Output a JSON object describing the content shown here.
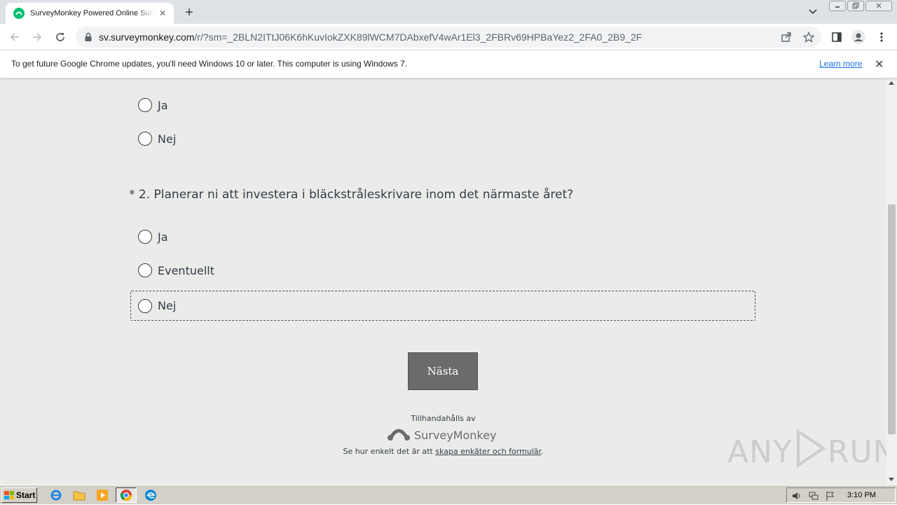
{
  "browser": {
    "tab_title": "SurveyMonkey Powered Online Survey",
    "tab_close": "✕",
    "new_tab": "+",
    "url_host": "sv.surveymonkey.com",
    "url_path": "/r/?sm=_2BLN2ITtJ06K6hKuvIokZXK89lWCM7DAbxefV4wAr1El3_2FBRv69HPBaYez2_2FA0_2B9_2F",
    "window_controls": [
      "minimize",
      "restore",
      "close"
    ]
  },
  "infobar": {
    "message": "To get future Google Chrome updates, you'll need Windows 10 or later. This computer is using Windows 7.",
    "learn_more": "Learn more",
    "close": "✕"
  },
  "survey": {
    "q1_options": [
      "Ja",
      "Nej"
    ],
    "q2": {
      "required_marker": "*",
      "text": "2. Planerar ni att investera i bläckstråleskrivare inom det närmaste året?",
      "options": [
        "Ja",
        "Eventuellt",
        "Nej"
      ]
    },
    "next_label": "Nästa"
  },
  "footer": {
    "powered_by": "Tillhandahålls av",
    "brand": "SurveyMonkey",
    "cta_prefix": "Se hur enkelt det är att ",
    "cta_link": "skapa enkäter och formulär",
    "cta_suffix": "."
  },
  "watermark": {
    "left": "ANY",
    "right": "RUN"
  },
  "taskbar": {
    "start_label": "Start",
    "clock": "3:10 PM"
  },
  "colors": {
    "page_bg": "#ebebe9",
    "text": "#333e48",
    "button_bg": "#6b6b6b",
    "brand_green": "#00bf6f",
    "link_blue": "#1a73e8"
  }
}
